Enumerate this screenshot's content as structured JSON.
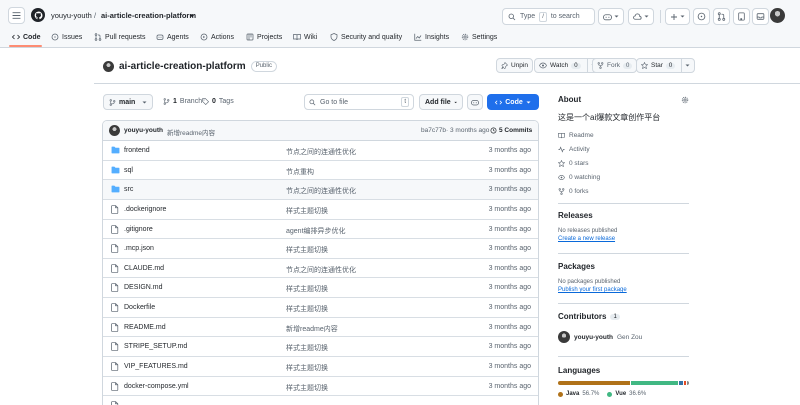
{
  "header": {
    "owner": "youyu-youth",
    "separator": "/",
    "repo": "ai-article-creation-platform",
    "search_placeholder": "Type",
    "search_kbd": "/",
    "search_suffix": "to search"
  },
  "nav": {
    "tabs": [
      {
        "label": "Code",
        "icon": "code-icon"
      },
      {
        "label": "Issues",
        "icon": "issue-icon"
      },
      {
        "label": "Pull requests",
        "icon": "pull-request-icon"
      },
      {
        "label": "Agents",
        "icon": "agents-icon"
      },
      {
        "label": "Actions",
        "icon": "actions-icon"
      },
      {
        "label": "Projects",
        "icon": "projects-icon"
      },
      {
        "label": "Wiki",
        "icon": "wiki-icon"
      },
      {
        "label": "Security and quality",
        "icon": "shield-icon"
      },
      {
        "label": "Insights",
        "icon": "graph-icon"
      },
      {
        "label": "Settings",
        "icon": "gear-icon"
      }
    ]
  },
  "repo": {
    "name": "ai-article-creation-platform",
    "visibility": "Public",
    "unpin": "Unpin",
    "watch": "Watch",
    "watch_count": "0",
    "fork": "Fork",
    "fork_count": "0",
    "star": "Star",
    "star_count": "0"
  },
  "toolbar": {
    "branch": "main",
    "branches_count": "1",
    "branches_label": "Branch",
    "tags_count": "0",
    "tags_label": "Tags",
    "goto_placeholder": "Go to file",
    "goto_kbd": "t",
    "add_file": "Add file",
    "code": "Code"
  },
  "latest_commit": {
    "author": "youyu-youth",
    "message": "新增readme内容",
    "hash": "ba7c77b",
    "dot": "·",
    "time": "3 months ago",
    "commits": "5 Commits"
  },
  "files": [
    {
      "name": "frontend",
      "type": "dir",
      "message": "节点之间的连通性优化",
      "time": "3 months ago"
    },
    {
      "name": "sql",
      "type": "dir",
      "message": "节点重构",
      "time": "3 months ago"
    },
    {
      "name": "src",
      "type": "dir",
      "message": "节点之间的连通性优化",
      "time": "3 months ago"
    },
    {
      "name": ".dockerignore",
      "type": "file",
      "message": "样式主题切换",
      "time": "3 months ago"
    },
    {
      "name": ".gitignore",
      "type": "file",
      "message": "agent编排异步优化",
      "time": "3 months ago"
    },
    {
      "name": ".mcp.json",
      "type": "file",
      "message": "样式主题切换",
      "time": "3 months ago"
    },
    {
      "name": "CLAUDE.md",
      "type": "file",
      "message": "节点之间的连通性优化",
      "time": "3 months ago"
    },
    {
      "name": "DESIGN.md",
      "type": "file",
      "message": "样式主题切换",
      "time": "3 months ago"
    },
    {
      "name": "Dockerfile",
      "type": "file",
      "message": "样式主题切换",
      "time": "3 months ago"
    },
    {
      "name": "README.md",
      "type": "file",
      "message": "新增readme内容",
      "time": "3 months ago"
    },
    {
      "name": "STRIPE_SETUP.md",
      "type": "file",
      "message": "样式主题切换",
      "time": "3 months ago"
    },
    {
      "name": "VIP_FEATURES.md",
      "type": "file",
      "message": "样式主题切换",
      "time": "3 months ago"
    },
    {
      "name": "docker-compose.yml",
      "type": "file",
      "message": "样式主题切换",
      "time": "3 months ago"
    },
    {
      "name": "",
      "type": "file",
      "message": "",
      "time": ""
    }
  ],
  "about": {
    "title": "About",
    "description": "这是一个ai爆款文章创作平台",
    "readme": "Readme",
    "activity": "Activity",
    "stars": "0 stars",
    "watching": "0 watching",
    "forks": "0 forks"
  },
  "releases": {
    "title": "Releases",
    "none": "No releases published",
    "create": "Create a new release"
  },
  "packages": {
    "title": "Packages",
    "none": "No packages published",
    "publish": "Publish your first package"
  },
  "contributors": {
    "title": "Contributors",
    "count": "1",
    "user": "youyu-youth",
    "name": "Gen Zou"
  },
  "languages": {
    "title": "Languages",
    "items": [
      {
        "name": "Java",
        "percent": "56.7%",
        "value": 56.7,
        "color": "#b07219"
      },
      {
        "name": "Vue",
        "percent": "36.6%",
        "value": 36.6,
        "color": "#41b883"
      },
      {
        "name": "",
        "percent": "",
        "value": 3.5,
        "color": "#3572a5"
      },
      {
        "name": "",
        "percent": "",
        "value": 1.8,
        "color": "#e34c26"
      },
      {
        "name": "",
        "percent": "",
        "value": 1.4,
        "color": "#888888"
      }
    ]
  },
  "colors": {
    "accent": "#1f6feb",
    "link": "#0969da",
    "folder": "#54aeff",
    "underline": "#fd8c73"
  }
}
